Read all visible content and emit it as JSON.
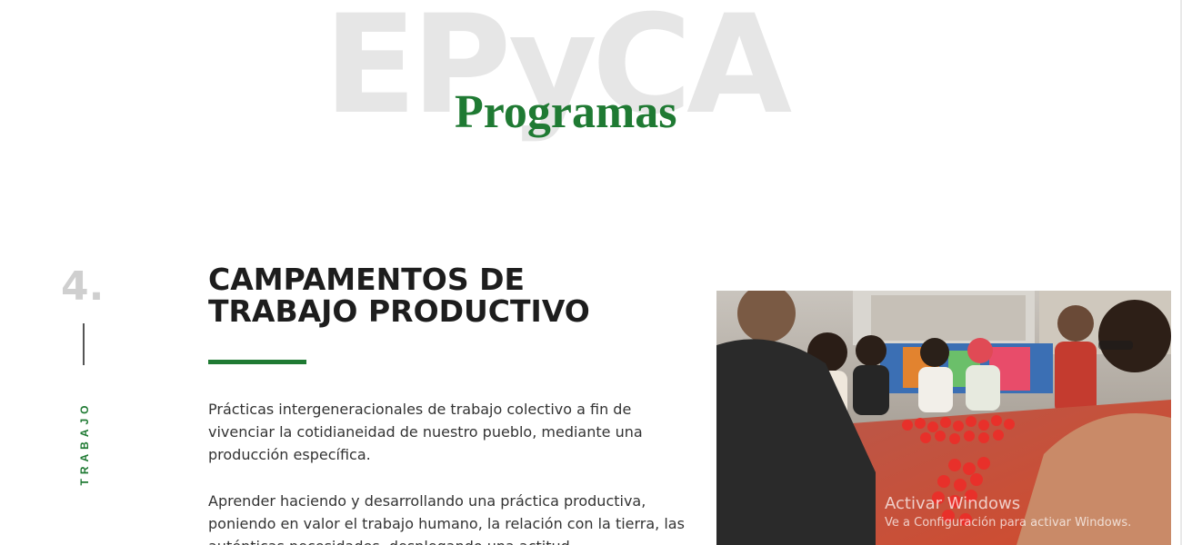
{
  "header": {
    "watermark": "EPyCA",
    "title": "Programas"
  },
  "program": {
    "number": "4.",
    "category": "TRABAJO",
    "heading_lines": [
      "CAMPAMENTOS DE",
      "TRABAJO PRODUCTIVO"
    ],
    "paragraphs": [
      "Prácticas intergeneracionales de trabajo colectivo a fin de vivenciar la cotidianeidad de nuestro pueblo, mediante una producción específica.",
      "Aprender haciendo y desarrollando una práctica productiva, poniendo en valor el trabajo humano, la relación con la tierra, las auténticas necesidades, desplegando una actitud"
    ],
    "photo": {
      "description": "Grupo de personas clasificando tomates alrededor de una mesa"
    }
  },
  "os_watermark": {
    "title": "Activar Windows",
    "subtitle": "Ve a Configuración para activar Windows."
  },
  "colors": {
    "accent_green": "#1f7a33",
    "heading_dark": "#1d1d1d",
    "number_gray": "#cfcfcf",
    "watermark_gray": "#e6e6e6"
  }
}
